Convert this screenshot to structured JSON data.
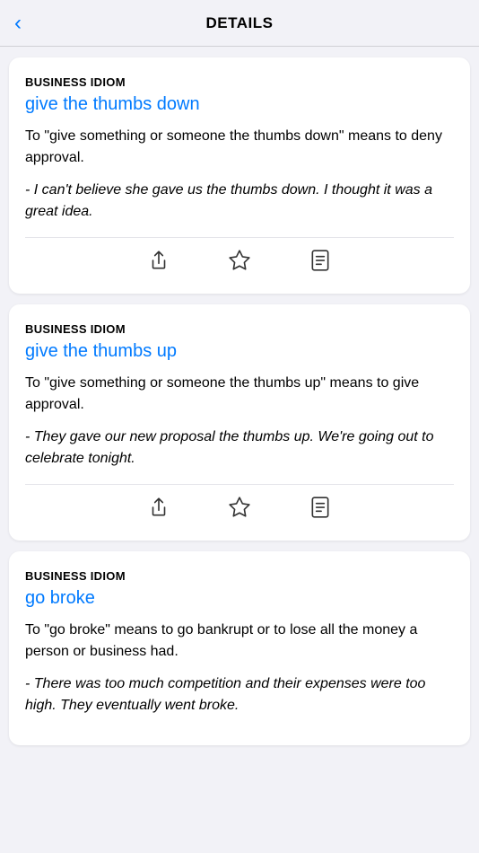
{
  "header": {
    "title": "DETAILS",
    "back_label": "‹"
  },
  "cards": [
    {
      "id": "card-1",
      "category": "BUSINESS IDIOM",
      "title": "give the thumbs down",
      "definition": "To \"give something or someone the thumbs down\" means to deny approval.",
      "example": "- I can't believe she gave us the thumbs down. I thought it was a great idea."
    },
    {
      "id": "card-2",
      "category": "BUSINESS IDIOM",
      "title": "give the thumbs up",
      "definition": "To \"give something or someone the thumbs up\" means to give approval.",
      "example": "- They gave our new proposal the thumbs up. We're going out to celebrate tonight."
    },
    {
      "id": "card-3",
      "category": "BUSINESS IDIOM",
      "title": "go broke",
      "definition": "To \"go broke\" means to go bankrupt or to lose all the money a person or business had.",
      "example": "- There was too much competition and their expenses were too high. They eventually went broke."
    }
  ],
  "actions": {
    "share_label": "share",
    "favorite_label": "favorite",
    "notes_label": "notes"
  }
}
